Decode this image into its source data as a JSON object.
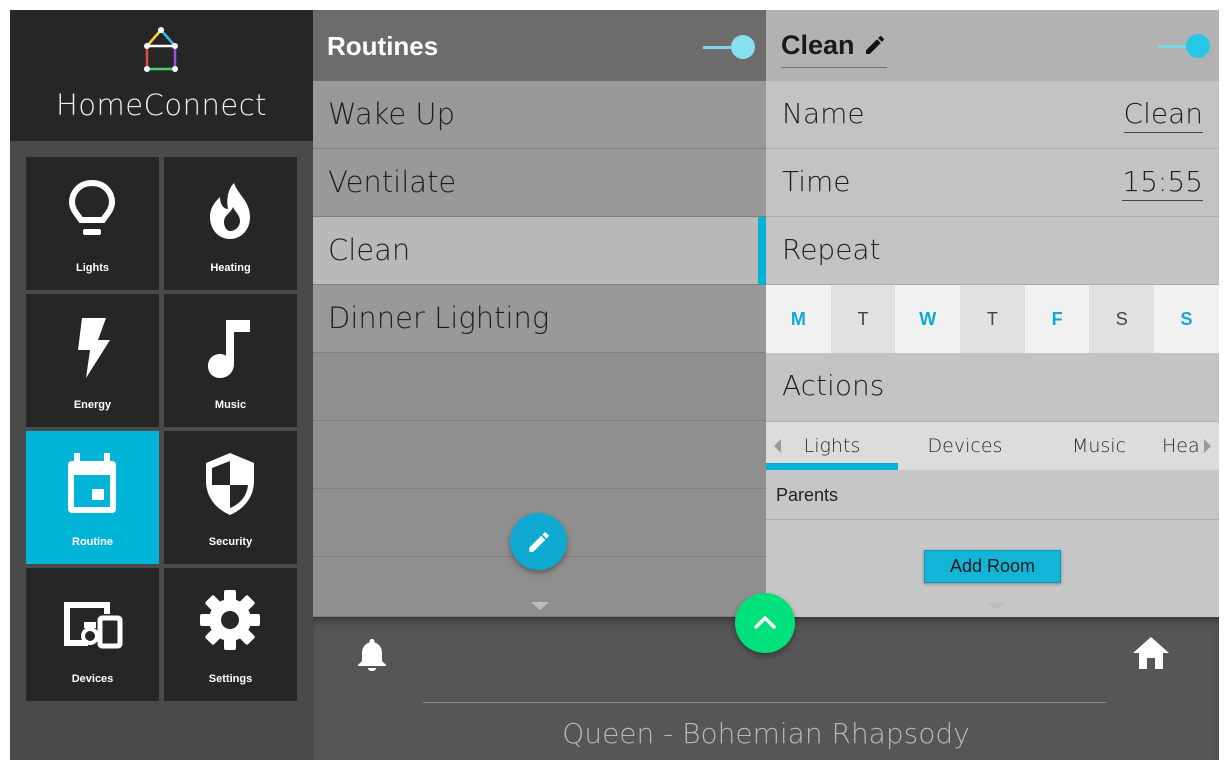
{
  "app": {
    "name": "HomeConnect"
  },
  "nav": {
    "tiles": [
      {
        "label": "Lights",
        "icon": "lightbulb-icon",
        "active": false
      },
      {
        "label": "Heating",
        "icon": "flame-icon",
        "active": false
      },
      {
        "label": "Energy",
        "icon": "lightning-icon",
        "active": false
      },
      {
        "label": "Music",
        "icon": "music-note-icon",
        "active": false
      },
      {
        "label": "Routine",
        "icon": "calendar-icon",
        "active": true
      },
      {
        "label": "Security",
        "icon": "shield-icon",
        "active": false
      },
      {
        "label": "Devices",
        "icon": "devices-icon",
        "active": false
      },
      {
        "label": "Settings",
        "icon": "gear-icon",
        "active": false
      }
    ]
  },
  "routines": {
    "title": "Routines",
    "enabled": true,
    "items": [
      "Wake Up",
      "Ventilate",
      "Clean",
      "Dinner Lighting"
    ],
    "selected": "Clean"
  },
  "details": {
    "title": "Clean",
    "enabled": true,
    "name_label": "Name",
    "name_value": "Clean",
    "time_label": "Time",
    "time_value": "15:55",
    "repeat_label": "Repeat",
    "days": [
      {
        "letter": "M",
        "on": true
      },
      {
        "letter": "T",
        "on": false
      },
      {
        "letter": "W",
        "on": true
      },
      {
        "letter": "T",
        "on": false
      },
      {
        "letter": "F",
        "on": true
      },
      {
        "letter": "S",
        "on": false
      },
      {
        "letter": "S",
        "on": true
      }
    ],
    "actions_label": "Actions",
    "tabs": [
      "Lights",
      "Devices",
      "Music",
      "Hea"
    ],
    "active_tab": "Lights",
    "room": "Parents",
    "add_room_label": "Add Room"
  },
  "player": {
    "now_playing": "Queen - Bohemian Rhapsody"
  },
  "colors": {
    "accent": "#00b4d8",
    "fab_green": "#00e07a",
    "tile_bg": "#262626"
  }
}
